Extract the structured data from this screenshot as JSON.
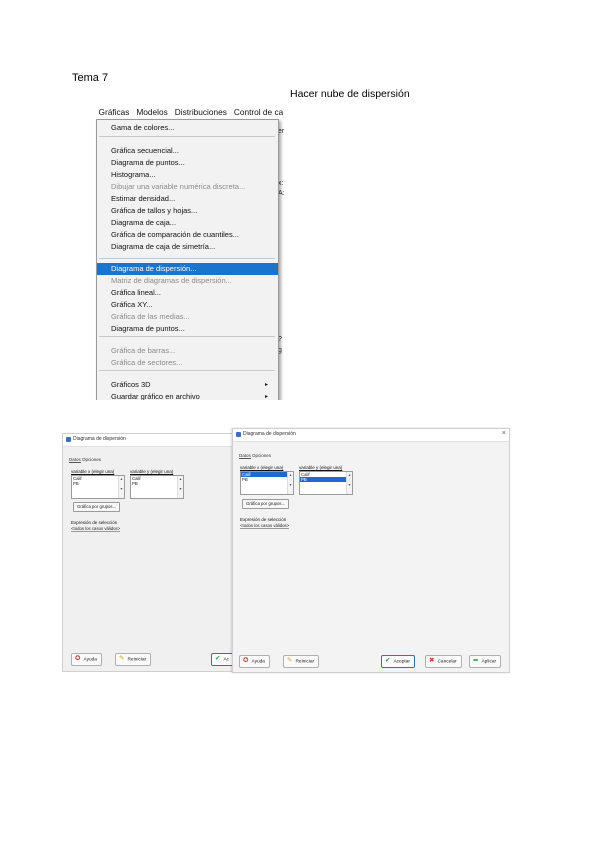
{
  "doc": {
    "title": "Tema 7",
    "subtitle": "Hacer nube de dispersión"
  },
  "menu": {
    "bar": [
      "Gráficas",
      "Modelos",
      "Distribuciones",
      "Control de ca"
    ],
    "background_fragments": [
      "er",
      "x:",
      "A:",
      "?",
      "g"
    ],
    "items": [
      {
        "label": "Gama de colores...",
        "disabled": false,
        "selected": false,
        "submenu": false
      },
      {
        "label": "Gráfica secuencial...",
        "disabled": false,
        "selected": false,
        "submenu": false
      },
      {
        "label": "Diagrama de puntos...",
        "disabled": false,
        "selected": false,
        "submenu": false
      },
      {
        "label": "Histograma...",
        "disabled": false,
        "selected": false,
        "submenu": false
      },
      {
        "label": "Dibujar una variable numérica discreta...",
        "disabled": true,
        "selected": false,
        "submenu": false
      },
      {
        "label": "Estimar densidad...",
        "disabled": false,
        "selected": false,
        "submenu": false
      },
      {
        "label": "Gráfica de tallos y hojas...",
        "disabled": false,
        "selected": false,
        "submenu": false
      },
      {
        "label": "Diagrama de caja...",
        "disabled": false,
        "selected": false,
        "submenu": false
      },
      {
        "label": "Gráfica de comparación de cuantiles...",
        "disabled": false,
        "selected": false,
        "submenu": false
      },
      {
        "label": "Diagrama de caja de simetría...",
        "disabled": false,
        "selected": false,
        "submenu": false
      },
      {
        "label": "Diagrama de dispersión...",
        "disabled": false,
        "selected": true,
        "submenu": false
      },
      {
        "label": "Matriz de diagramas de dispersión...",
        "disabled": true,
        "selected": false,
        "submenu": false
      },
      {
        "label": "Gráfica lineal...",
        "disabled": false,
        "selected": false,
        "submenu": false
      },
      {
        "label": "Gráfica XY...",
        "disabled": false,
        "selected": false,
        "submenu": false
      },
      {
        "label": "Gráfica de las medias...",
        "disabled": true,
        "selected": false,
        "submenu": false
      },
      {
        "label": "Diagrama de puntos...",
        "disabled": false,
        "selected": false,
        "submenu": false
      },
      {
        "label": "Gráfica de barras...",
        "disabled": true,
        "selected": false,
        "submenu": false
      },
      {
        "label": "Gráfica de sectores...",
        "disabled": true,
        "selected": false,
        "submenu": false
      },
      {
        "label": "Gráficos 3D",
        "disabled": false,
        "selected": false,
        "submenu": true
      },
      {
        "label": "Guardar gráfico en archivo",
        "disabled": false,
        "selected": false,
        "submenu": true
      }
    ],
    "submenu_arrow": "▸"
  },
  "dialog1": {
    "title": "Diagrama de dispersión",
    "tabs": [
      "Datos",
      "Opciones"
    ],
    "xvar_label": "variable x (elegir una)",
    "yvar_label": "variable y (elegir una)",
    "xvar_items": [
      "Calif",
      "PB"
    ],
    "yvar_items": [
      "Calif",
      "PB"
    ],
    "plot_groups_button": "Gráfica por grupos...",
    "subset_label": "Expresión de selección",
    "subset_value": "<todos los casos válidos>",
    "help_button": "Ayuda",
    "reset_button": "Reiniciar",
    "ok_partial": "Ac"
  },
  "dialog2": {
    "title": "Diagrama de dispersión",
    "close": "×",
    "tabs": [
      "Datos",
      "Opciones"
    ],
    "xvar_label": "variable x (elegir una)",
    "yvar_label": "variable y (elegir una)",
    "xvar_items": [
      "Calif",
      "PB"
    ],
    "yvar_items": [
      "Calif",
      "PB"
    ],
    "xvar_selected": 0,
    "yvar_selected": 1,
    "plot_groups_button": "Gráfica por grupos...",
    "subset_label": "Expresión de selección",
    "subset_value": "<todos los casos válidos>",
    "help_button": "Ayuda",
    "reset_button": "Reiniciar",
    "ok_button": "Aceptar",
    "cancel_button": "Cancelar",
    "apply_button": "Aplicar"
  },
  "colors": {
    "selection": "#1874cd",
    "list_selection": "#1e6ad2",
    "disabled_text": "#8a8a8a",
    "ok_icon": "#2c9a3a",
    "cancel_icon": "#d03a2f"
  },
  "icons": {
    "help": "help-lifebuoy-icon",
    "reset": "reset-pencil-icon",
    "ok": "checkmark-icon",
    "cancel": "x-cancel-icon",
    "apply": "apply-arrow-icon"
  }
}
